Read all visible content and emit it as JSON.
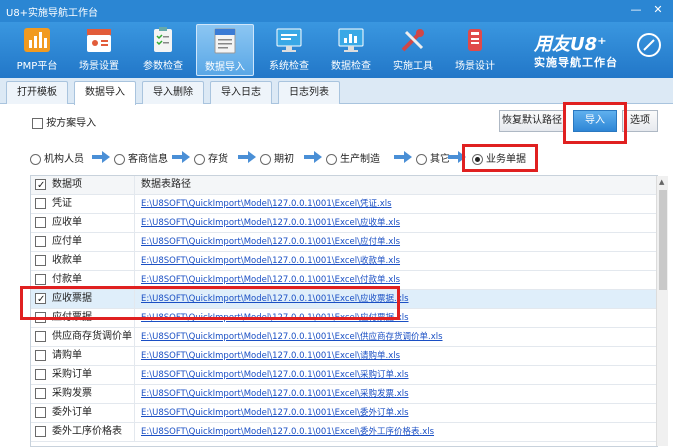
{
  "window": {
    "title": "U8+实施导航工作台",
    "controls": [
      "—",
      "✕"
    ]
  },
  "toolbar": {
    "items": [
      {
        "label": "PMP平台",
        "icon": "chart-bar-icon",
        "color": "#f19a20"
      },
      {
        "label": "场景设置",
        "icon": "film-clapper-icon",
        "color": "#e25c3a"
      },
      {
        "label": "参数检查",
        "icon": "clipboard-check-icon",
        "color": "#f4f4f4"
      },
      {
        "label": "数据导入",
        "icon": "file-import-icon",
        "color": "#f4f4f4",
        "active": true
      },
      {
        "label": "系统检查",
        "icon": "monitor-icon",
        "color": "#39a8e6"
      },
      {
        "label": "数据检查",
        "icon": "monitor-chart-icon",
        "color": "#39a8e6"
      },
      {
        "label": "实施工具",
        "icon": "tools-icon",
        "color": "#d04747"
      },
      {
        "label": "场景设计",
        "icon": "flask-icon",
        "color": "#e04a4a"
      }
    ],
    "brand_line1": "用友U8⁺",
    "brand_line2": "实施导航工作台"
  },
  "tabs": [
    {
      "label": "打开模板"
    },
    {
      "label": "数据导入",
      "active": true
    },
    {
      "label": "导入删除"
    },
    {
      "label": "导入日志"
    },
    {
      "label": "日志列表"
    }
  ],
  "options": {
    "by_plan_label": "按方案导入",
    "restore_path_label": "恢复默认路径",
    "import_label": "导入",
    "options_label": "选项"
  },
  "steps": [
    {
      "label": "机构人员",
      "selected": false
    },
    {
      "label": "客商信息",
      "selected": false
    },
    {
      "label": "存货",
      "selected": false
    },
    {
      "label": "期初",
      "selected": false
    },
    {
      "label": "生产制造",
      "selected": false
    },
    {
      "label": "其它",
      "selected": false
    },
    {
      "label": "业务单据",
      "selected": true
    }
  ],
  "table": {
    "col_item": "数据项",
    "col_path": "数据表路径",
    "rows": [
      {
        "item": "凭证",
        "path": "E:\\U8SOFT\\QuickImport\\Model\\127.0.0.1\\001\\Excel\\凭证.xls",
        "checked": false
      },
      {
        "item": "应收单",
        "path": "E:\\U8SOFT\\QuickImport\\Model\\127.0.0.1\\001\\Excel\\应收单.xls",
        "checked": false
      },
      {
        "item": "应付单",
        "path": "E:\\U8SOFT\\QuickImport\\Model\\127.0.0.1\\001\\Excel\\应付单.xls",
        "checked": false
      },
      {
        "item": "收款单",
        "path": "E:\\U8SOFT\\QuickImport\\Model\\127.0.0.1\\001\\Excel\\收款单.xls",
        "checked": false
      },
      {
        "item": "付款单",
        "path": "E:\\U8SOFT\\QuickImport\\Model\\127.0.0.1\\001\\Excel\\付款单.xls",
        "checked": false
      },
      {
        "item": "应收票据",
        "path": "E:\\U8SOFT\\QuickImport\\Model\\127.0.0.1\\001\\Excel\\应收票据.xls",
        "checked": true,
        "selected": true
      },
      {
        "item": "应付票据",
        "path": "E:\\U8SOFT\\QuickImport\\Model\\127.0.0.1\\001\\Excel\\应付票据.xls",
        "checked": false
      },
      {
        "item": "供应商存货调价单",
        "path": "E:\\U8SOFT\\QuickImport\\Model\\127.0.0.1\\001\\Excel\\供应商存货调价单.xls",
        "checked": false
      },
      {
        "item": "请购单",
        "path": "E:\\U8SOFT\\QuickImport\\Model\\127.0.0.1\\001\\Excel\\请购单.xls",
        "checked": false
      },
      {
        "item": "采购订单",
        "path": "E:\\U8SOFT\\QuickImport\\Model\\127.0.0.1\\001\\Excel\\采购订单.xls",
        "checked": false
      },
      {
        "item": "采购发票",
        "path": "E:\\U8SOFT\\QuickImport\\Model\\127.0.0.1\\001\\Excel\\采购发票.xls",
        "checked": false
      },
      {
        "item": "委外订单",
        "path": "E:\\U8SOFT\\QuickImport\\Model\\127.0.0.1\\001\\Excel\\委外订单.xls",
        "checked": false
      },
      {
        "item": "委外工序价格表",
        "path": "E:\\U8SOFT\\QuickImport\\Model\\127.0.0.1\\001\\Excel\\委外工序价格表.xls",
        "checked": false
      }
    ]
  }
}
